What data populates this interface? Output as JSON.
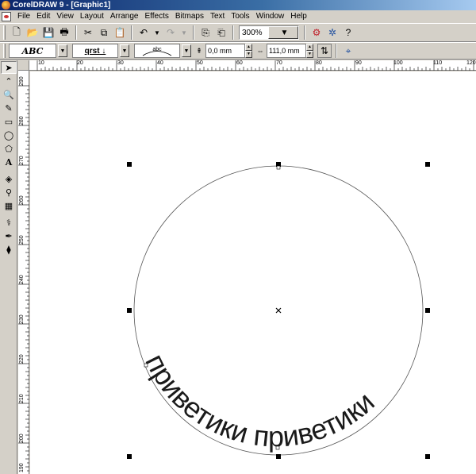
{
  "window": {
    "title": "CorelDRAW 9 - [Graphic1]"
  },
  "menu": [
    "File",
    "Edit",
    "View",
    "Layout",
    "Arrange",
    "Effects",
    "Bitmaps",
    "Text",
    "Tools",
    "Window",
    "Help"
  ],
  "standard_toolbar": {
    "zoom_value": "300%"
  },
  "property_bar": {
    "text_style_preview": "ABC",
    "orientation_preview": "qrst",
    "placement_preview": "abc",
    "distance_value": "0,0 mm",
    "offset_value": "111,0 mm"
  },
  "rulers": {
    "horizontal": [
      "10",
      "20",
      "30",
      "40",
      "50",
      "60",
      "70",
      "80",
      "90",
      "100",
      "110",
      "120"
    ],
    "vertical": [
      "290",
      "280",
      "270",
      "260",
      "250",
      "240",
      "230",
      "220",
      "210",
      "200",
      "190"
    ]
  },
  "canvas": {
    "fit_text": "приветики приветики"
  }
}
